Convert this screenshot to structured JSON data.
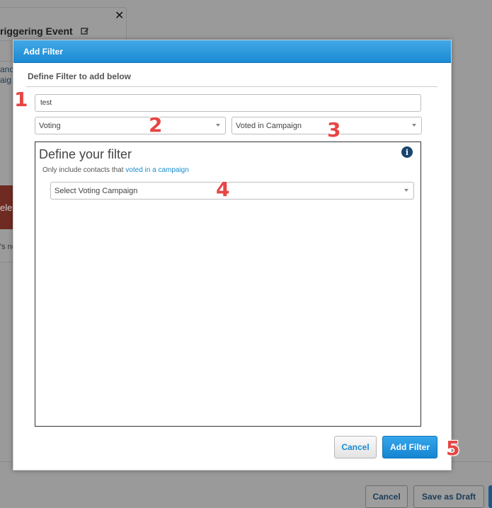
{
  "background": {
    "event_title": "riggering Event",
    "side_text_1": "anc",
    "side_text_2": "aig",
    "red_tile_text": "ele",
    "small_text": "'s ne",
    "footer": {
      "cancel_label": "Cancel",
      "save_draft_label": "Save as Draft"
    }
  },
  "modal": {
    "title": "Add Filter",
    "subtitle": "Define Filter to add below",
    "name_input_value": "test",
    "category_select": "Voting",
    "type_select": "Voted in Campaign",
    "filter_panel": {
      "heading": "Define your filter",
      "description_prefix": "Only include contacts that ",
      "description_link": "voted in a campaign",
      "campaign_select": "Select Voting Campaign"
    },
    "cancel_label": "Cancel",
    "add_label": "Add Filter"
  },
  "markers": [
    "1",
    "2",
    "3",
    "4",
    "5"
  ],
  "colors": {
    "header_blue": "#1b8ad3",
    "link_blue": "#1a8cd1",
    "marker_red": "#e74545",
    "info_icon": "#17456d"
  }
}
